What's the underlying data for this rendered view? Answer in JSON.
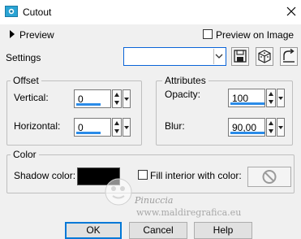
{
  "window": {
    "title": "Cutout",
    "close_icon": "close-icon",
    "app_icon": "cutout-app-icon"
  },
  "preview": {
    "label": "Preview",
    "preview_on_image_label": "Preview on Image",
    "preview_on_image_checked": false
  },
  "settings": {
    "label": "Settings",
    "preset_value": "",
    "buttons": [
      "save-preset-icon",
      "randomize-icon",
      "reset-icon"
    ]
  },
  "offset": {
    "group_label": "Offset",
    "vertical_label": "Vertical:",
    "vertical_value": "0",
    "horizontal_label": "Horizontal:",
    "horizontal_value": "0"
  },
  "attributes": {
    "group_label": "Attributes",
    "opacity_label": "Opacity:",
    "opacity_value": "100",
    "blur_label": "Blur:",
    "blur_value": "90,00"
  },
  "color": {
    "group_label": "Color",
    "shadow_color_label": "Shadow color:",
    "shadow_color": "#000000",
    "fill_interior_label": "Fill interior with color:",
    "fill_interior_checked": false
  },
  "buttons": {
    "ok": "OK",
    "cancel": "Cancel",
    "help": "Help"
  },
  "watermark": {
    "line1": "Pinuccia",
    "line2": "www.maldiregrafica.eu"
  },
  "colors": {
    "accent": "#0078d7",
    "dialog_bg": "#f0f0f0",
    "bar": "#2a8be8"
  }
}
